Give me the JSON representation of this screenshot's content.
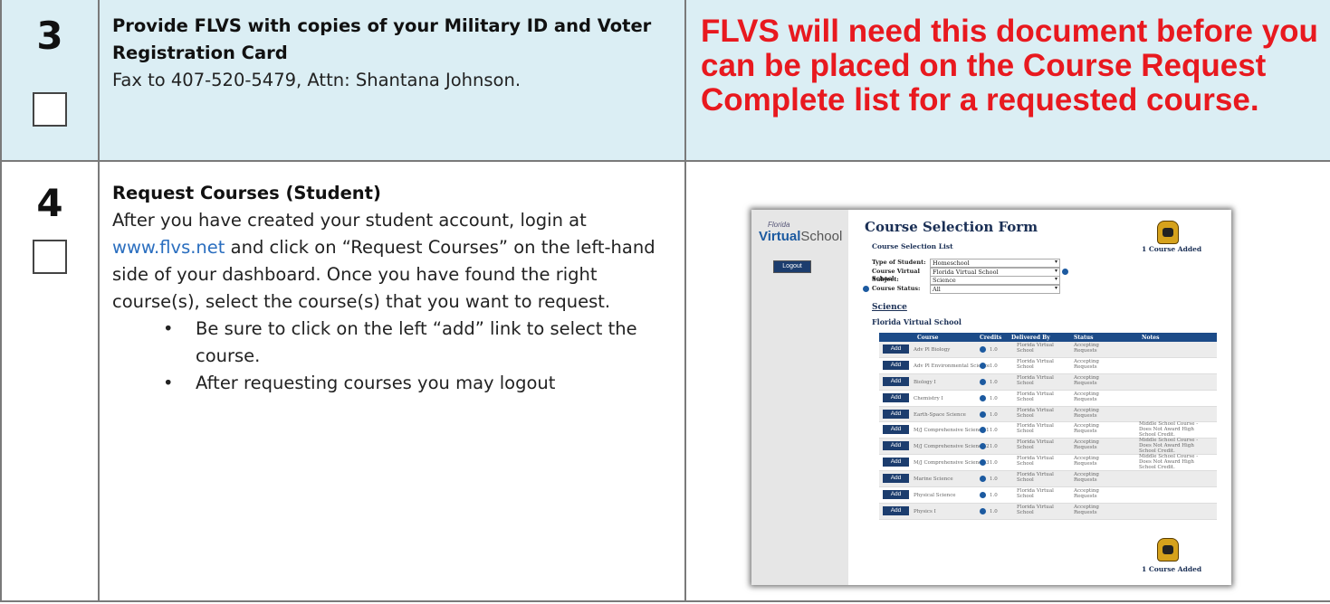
{
  "step3": {
    "number": "3",
    "title": "Provide FLVS with copies of your Military ID and Voter Registration Card",
    "body": "Fax to 407-520-5479, Attn: Shantana Johnson.",
    "note": "FLVS will need this document before you can be placed on the Course Request Complete list for a requested course."
  },
  "step4": {
    "number": "4",
    "title": "Request Courses (Student)",
    "body_before_link": "After you have created your student account, login at ",
    "link": "www.flvs.net",
    "body_after_link": " and click on “Request Courses” on the left-hand side of your dashboard. Once you have found the right course(s), select the course(s) that you want to request.",
    "bullets": [
      "Be sure to click on the left “add” link to select the course.",
      "After requesting courses you may logout"
    ]
  },
  "screenshot": {
    "logo_small": "Florida",
    "logo_big": "Virtual",
    "logo_rest": "School",
    "logout": "Logout",
    "form_title": "Course Selection Form",
    "list_title": "Course Selection List",
    "added_label": "1 Course Added",
    "fields": [
      {
        "label": "Type of Student:",
        "value": "Homeschool"
      },
      {
        "label": "Course Virtual School:",
        "value": "Florida Virtual School"
      },
      {
        "label": "Subject:",
        "value": "Science"
      },
      {
        "label": "Course Status:",
        "value": "All"
      }
    ],
    "subject_heading": "Science",
    "school_heading": "Florida Virtual School",
    "columns": [
      "Course",
      "Credits",
      "Delivered By",
      "Status",
      "Notes"
    ],
    "add_label": "Add",
    "rows": [
      {
        "course": "Adv Pl Biology",
        "credits": "1.0",
        "delivered": "Florida Virtual School",
        "status": "Accepting Requests",
        "notes": ""
      },
      {
        "course": "Adv Pl Environmental Science",
        "credits": "1.0",
        "delivered": "Florida Virtual School",
        "status": "Accepting Requests",
        "notes": ""
      },
      {
        "course": "Biology I",
        "credits": "1.0",
        "delivered": "Florida Virtual School",
        "status": "Accepting Requests",
        "notes": ""
      },
      {
        "course": "Chemistry I",
        "credits": "1.0",
        "delivered": "Florida Virtual School",
        "status": "Accepting Requests",
        "notes": ""
      },
      {
        "course": "Earth-Space Science",
        "credits": "1.0",
        "delivered": "Florida Virtual School",
        "status": "Accepting Requests",
        "notes": ""
      },
      {
        "course": "M/J Comprehensive Science 1",
        "credits": "1.0",
        "delivered": "Florida Virtual School",
        "status": "Accepting Requests",
        "notes": "Middle School Course - Does Not Award High School Credit."
      },
      {
        "course": "M/J Comprehensive Science 2",
        "credits": "1.0",
        "delivered": "Florida Virtual School",
        "status": "Accepting Requests",
        "notes": "Middle School Course - Does Not Award High School Credit."
      },
      {
        "course": "M/J Comprehensive Science 3",
        "credits": "1.0",
        "delivered": "Florida Virtual School",
        "status": "Accepting Requests",
        "notes": "Middle School Course - Does Not Award High School Credit."
      },
      {
        "course": "Marine Science",
        "credits": "1.0",
        "delivered": "Florida Virtual School",
        "status": "Accepting Requests",
        "notes": ""
      },
      {
        "course": "Physical Science",
        "credits": "1.0",
        "delivered": "Florida Virtual School",
        "status": "Accepting Requests",
        "notes": ""
      },
      {
        "course": "Physics I",
        "credits": "1.0",
        "delivered": "Florida Virtual School",
        "status": "Accepting Requests",
        "notes": ""
      }
    ]
  }
}
